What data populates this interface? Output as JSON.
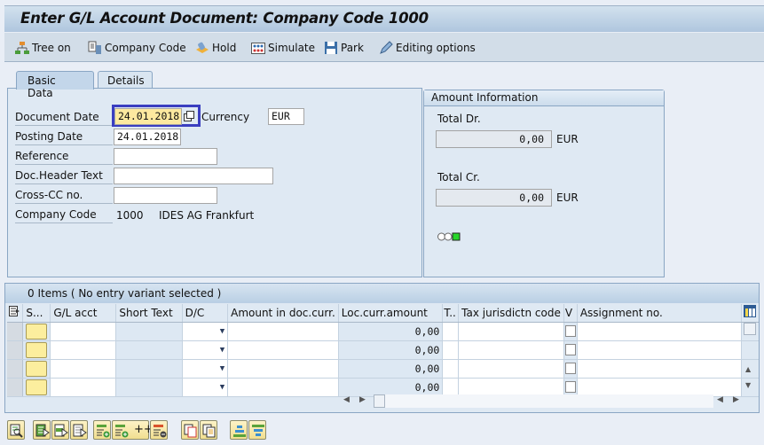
{
  "window": {
    "title": "Enter G/L Account Document: Company Code 1000"
  },
  "toolbar": {
    "items": [
      {
        "label": "Tree on",
        "icon": "tree-icon"
      },
      {
        "label": "Company Code",
        "icon": "company-code-icon"
      },
      {
        "label": "Hold",
        "icon": "hold-icon"
      },
      {
        "label": "Simulate",
        "icon": "simulate-icon"
      },
      {
        "label": "Park",
        "icon": "save-disk-icon"
      },
      {
        "label": "Editing options",
        "icon": "pencil-icon"
      }
    ]
  },
  "tabs": [
    {
      "label": "Basic Data",
      "active": true
    },
    {
      "label": "Details",
      "active": false
    }
  ],
  "basic_data": {
    "document_date": {
      "label": "Document Date",
      "value": "24.01.2018"
    },
    "currency": {
      "label": "Currency",
      "value": "EUR"
    },
    "posting_date": {
      "label": "Posting Date",
      "value": "24.01.2018"
    },
    "reference": {
      "label": "Reference",
      "value": ""
    },
    "doc_header_text": {
      "label": "Doc.Header Text",
      "value": ""
    },
    "cross_cc_no": {
      "label": "Cross-CC no.",
      "value": ""
    },
    "company_code": {
      "label": "Company Code",
      "value": "1000",
      "name": "IDES AG Frankfurt"
    }
  },
  "amount_info": {
    "title": "Amount Information",
    "total_dr": {
      "label": "Total Dr.",
      "value": "0,00",
      "currency": "EUR"
    },
    "total_cr": {
      "label": "Total Cr.",
      "value": "0,00",
      "currency": "EUR"
    },
    "status_light": "green"
  },
  "grid": {
    "title": "0 Items ( No entry variant selected )",
    "columns": [
      "S...",
      "G/L acct",
      "Short Text",
      "D/C",
      "Amount in doc.curr.",
      "Loc.curr.amount",
      "T..",
      "Tax jurisdictn code",
      "V",
      "Assignment no."
    ],
    "rows": [
      {
        "gl_acct": "",
        "short_text": "",
        "dc": "",
        "amount": "",
        "loc_amount": "0,00",
        "t": "",
        "tax": "",
        "assignment": ""
      },
      {
        "gl_acct": "",
        "short_text": "",
        "dc": "",
        "amount": "",
        "loc_amount": "0,00",
        "t": "",
        "tax": "",
        "assignment": ""
      },
      {
        "gl_acct": "",
        "short_text": "",
        "dc": "",
        "amount": "",
        "loc_amount": "0,00",
        "t": "",
        "tax": "",
        "assignment": ""
      },
      {
        "gl_acct": "",
        "short_text": "",
        "dc": "",
        "amount": "",
        "loc_amount": "0,00",
        "t": "",
        "tax": "",
        "assignment": ""
      }
    ]
  },
  "bottom_toolbar": {
    "insert_many_label": "++",
    "buttons": [
      "details-icon",
      "select-all-icon",
      "select-block-icon",
      "deselect-all-icon",
      "insert-row-icon",
      "insert-rows-icon",
      "delete-row-icon",
      "copy-icon",
      "paste-icon",
      "sort-ascending-icon",
      "filter-icon"
    ]
  }
}
